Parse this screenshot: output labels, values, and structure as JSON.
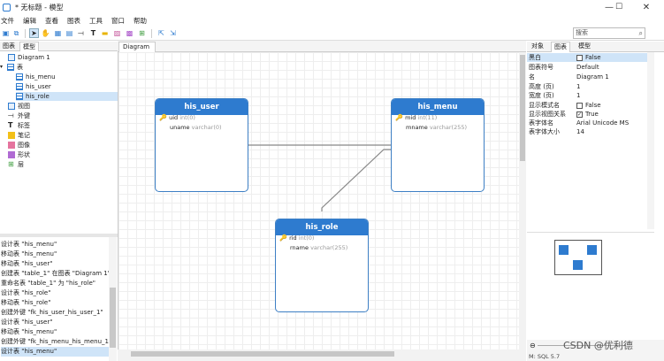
{
  "window": {
    "title": "* 无标题 - 模型",
    "minimize": "—",
    "maximize": "☐",
    "close": "✕"
  },
  "menu": [
    "文件",
    "编辑",
    "查看",
    "图表",
    "工具",
    "窗口",
    "帮助"
  ],
  "search": {
    "placeholder": "搜索"
  },
  "left_tabs": {
    "diagram": "图表",
    "model": "模型"
  },
  "tree": {
    "diagram": "Diagram 1",
    "tables": "表",
    "table_items": [
      "his_menu",
      "his_user",
      "his_role"
    ],
    "others": [
      "视图",
      "外键",
      "标签",
      "笔记",
      "图像",
      "形状",
      "层"
    ]
  },
  "log": [
    "设计表 \"his_menu\"",
    "移动表 \"his_menu\"",
    "移动表 \"his_user\"",
    "创建表 \"table_1\" 在图表 \"Diagram 1\"",
    "重命名表 \"table_1\" 为 \"his_role\"",
    "设计表 \"his_role\"",
    "移动表 \"his_role\"",
    "创建外键 \"fk_his_user_his_user_1\"",
    "设计表 \"his_user\"",
    "移动表 \"his_menu\"",
    "创建外键 \"fk_his_menu_his_menu_1\"",
    "设计表 \"his_menu\""
  ],
  "diagram_tab": "Diagram 1",
  "tables": {
    "his_user": {
      "name": "his_user",
      "fields": [
        {
          "name": "uid",
          "type": "int(0)",
          "pk": true
        },
        {
          "name": "uname",
          "type": "varchar(0)",
          "pk": false
        }
      ]
    },
    "his_menu": {
      "name": "his_menu",
      "fields": [
        {
          "name": "mid",
          "type": "int(11)",
          "pk": true
        },
        {
          "name": "mname",
          "type": "varchar(255)",
          "pk": false
        }
      ]
    },
    "his_role": {
      "name": "his_role",
      "fields": [
        {
          "name": "rid",
          "type": "int(0)",
          "pk": true
        },
        {
          "name": "rname",
          "type": "varchar(255)",
          "pk": false
        }
      ]
    }
  },
  "right_tabs": {
    "objects": "对象",
    "diagram": "图表",
    "model": "模型"
  },
  "properties": [
    {
      "name": "黑白",
      "value": "False",
      "checkbox": "off"
    },
    {
      "name": "图表符号",
      "value": "Default",
      "checkbox": ""
    },
    {
      "name": "名",
      "value": "Diagram 1",
      "checkbox": ""
    },
    {
      "name": "高度 (页)",
      "value": "1",
      "checkbox": ""
    },
    {
      "name": "宽度 (页)",
      "value": "1",
      "checkbox": ""
    },
    {
      "name": "显示模式名",
      "value": "False",
      "checkbox": "off"
    },
    {
      "name": "显示视图关系",
      "value": "True",
      "checkbox": "on"
    },
    {
      "name": "表字体名",
      "value": "Arial Unicode MS",
      "checkbox": ""
    },
    {
      "name": "表字体大小",
      "value": "14",
      "checkbox": ""
    }
  ],
  "watermark": "CSDN @优利德",
  "status": "M: SQL 5.7",
  "colors": {
    "header_blue": "#2e7bcf",
    "selection": "#cfe4f8",
    "key_gold": "#d9a400"
  }
}
